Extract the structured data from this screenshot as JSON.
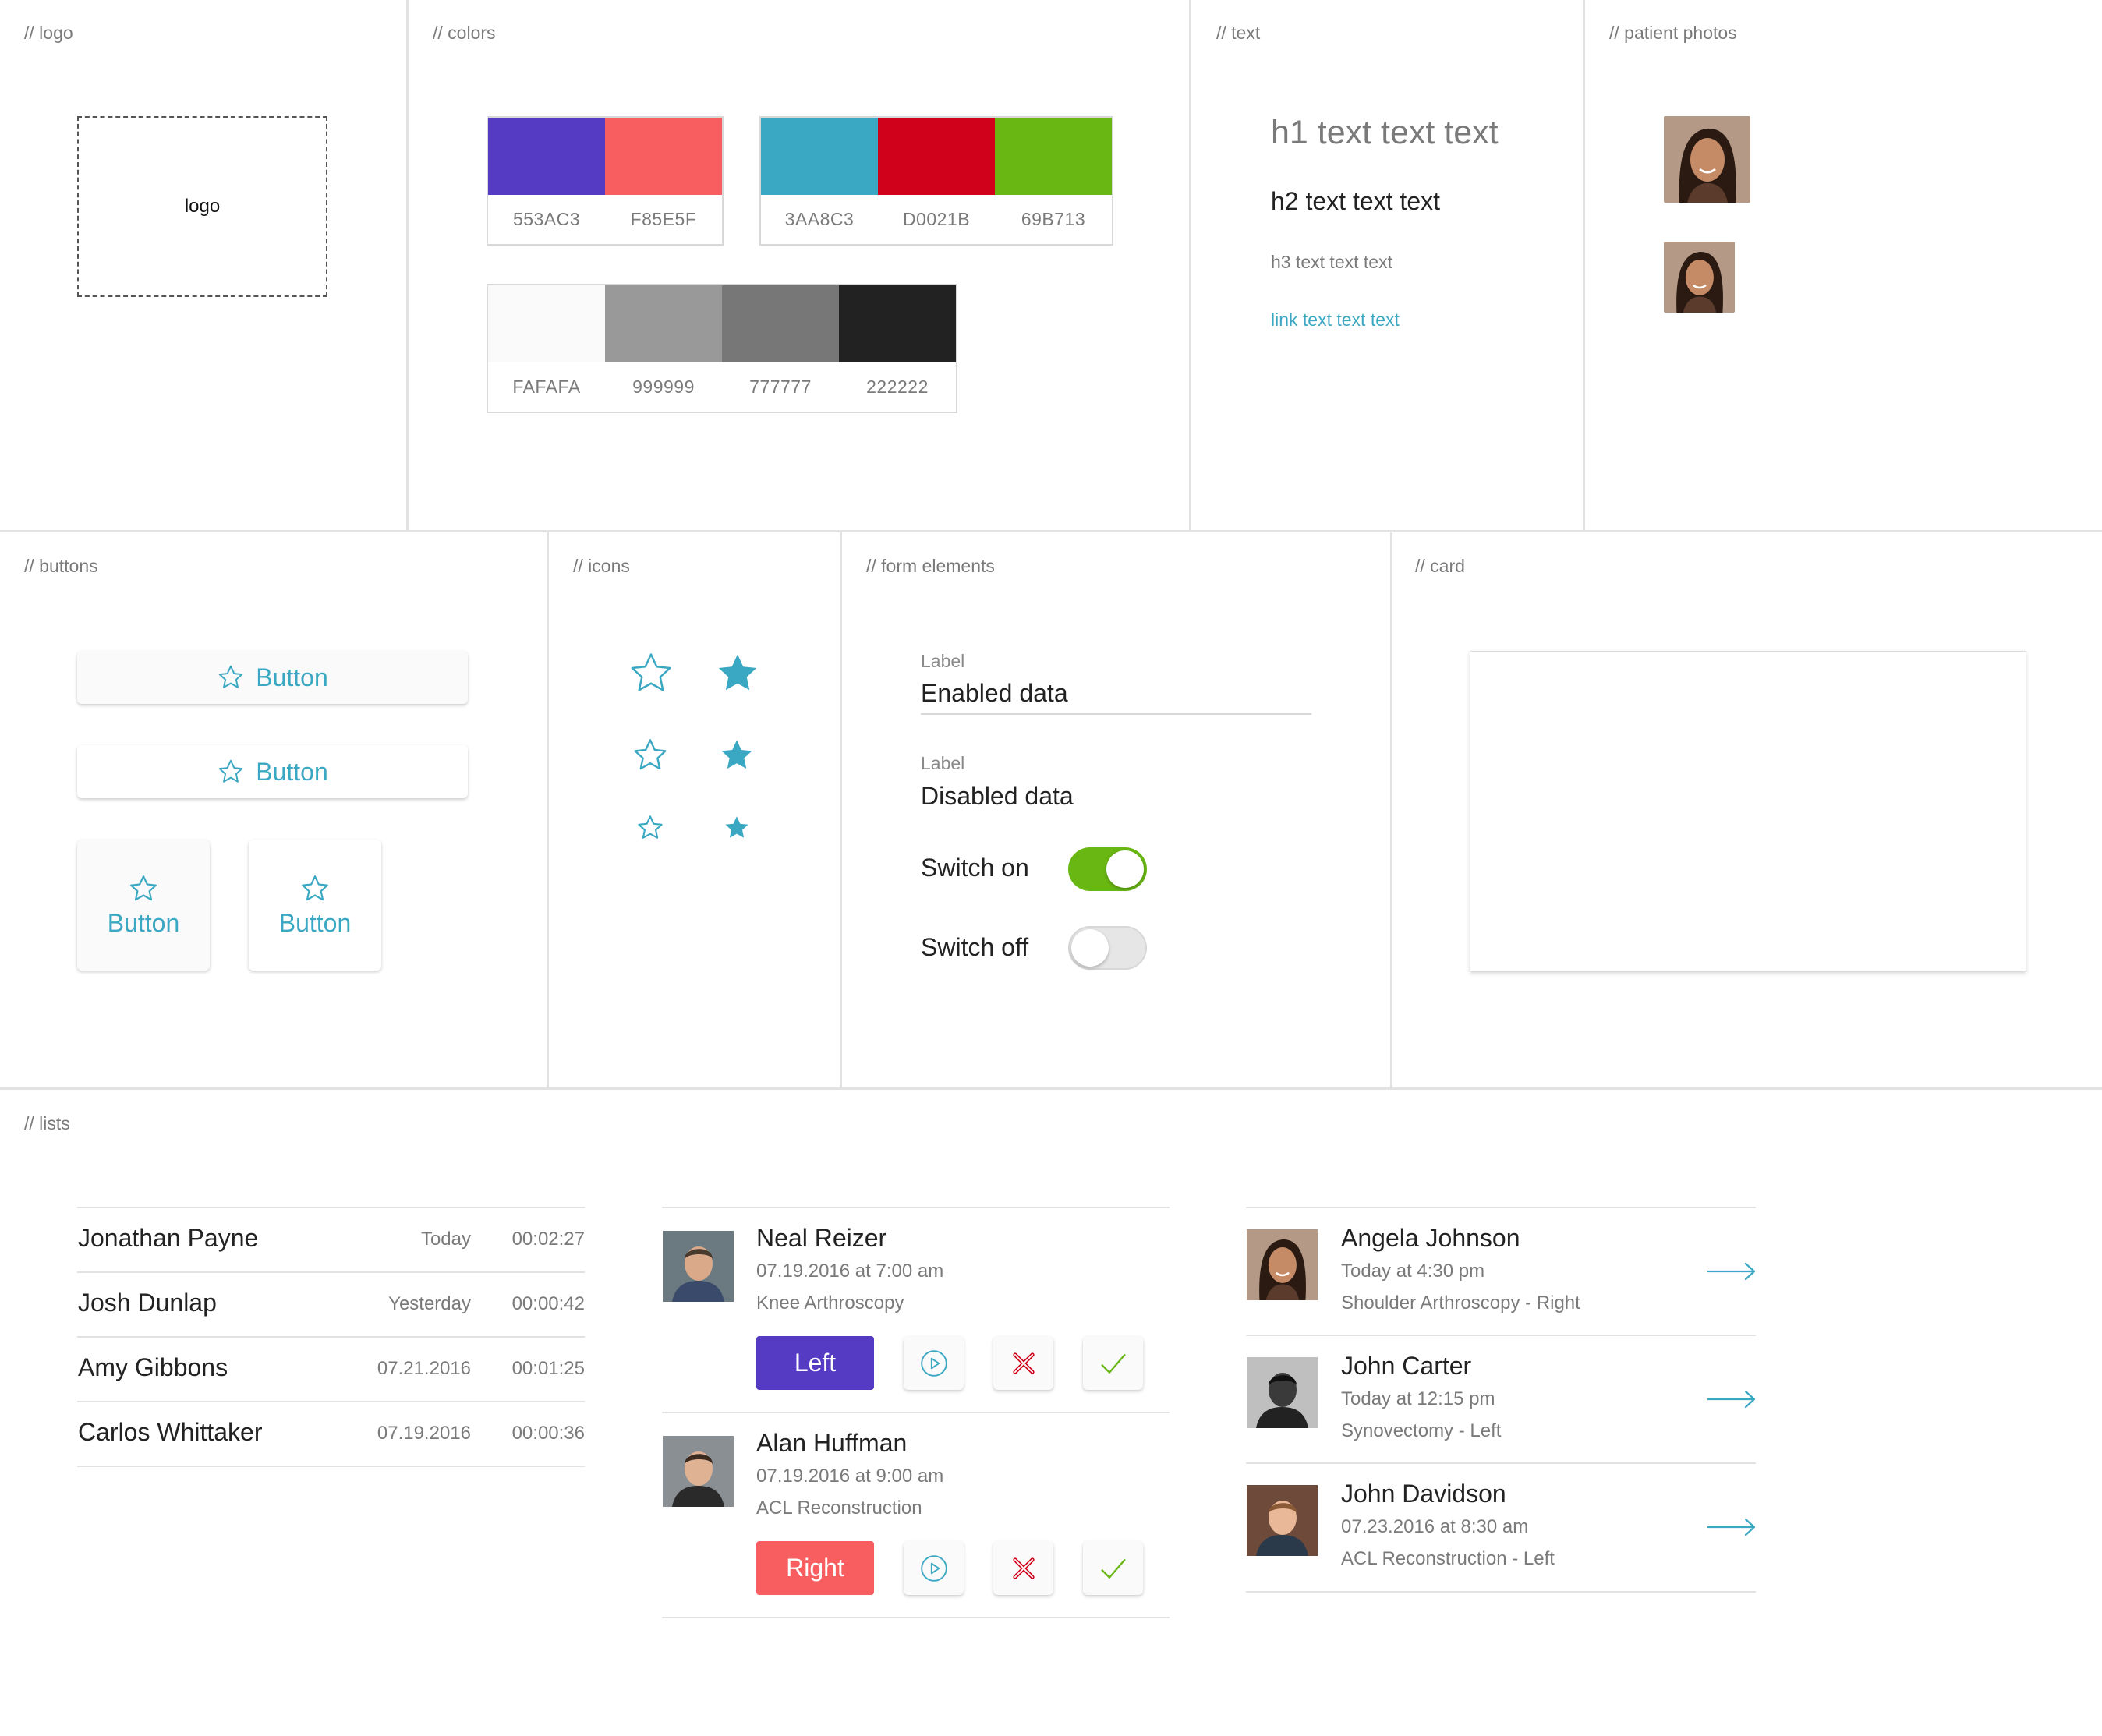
{
  "sections": {
    "logo": "// logo",
    "colors": "// colors",
    "text": "// text",
    "photos": "// patient photos",
    "buttons": "// buttons",
    "icons": "// icons",
    "form": "// form elements",
    "card": "// card",
    "lists": "// lists"
  },
  "logo_placeholder": "logo",
  "colors": {
    "brand": [
      {
        "hex": "#553AC3",
        "code": "553AC3"
      },
      {
        "hex": "#F85E5F",
        "code": "F85E5F"
      }
    ],
    "status": [
      {
        "hex": "#3AA8C3",
        "code": "3AA8C3"
      },
      {
        "hex": "#D0021B",
        "code": "D0021B"
      },
      {
        "hex": "#69B713",
        "code": "69B713"
      }
    ],
    "grays": [
      {
        "hex": "#FAFAFA",
        "code": "FAFAFA"
      },
      {
        "hex": "#999999",
        "code": "999999"
      },
      {
        "hex": "#777777",
        "code": "777777"
      },
      {
        "hex": "#222222",
        "code": "222222"
      }
    ]
  },
  "text_samples": {
    "h1": "h1 text text text",
    "h2": "h2 text text text",
    "h3": "h3 text text text",
    "link": "link text text text"
  },
  "buttons": {
    "raised_label": "Button",
    "flat_label": "Button",
    "square_raised_label": "Button",
    "square_flat_label": "Button",
    "icon": "star-outline-icon"
  },
  "icons": [
    "star-outline-icon",
    "star-filled-icon"
  ],
  "form": {
    "enabled_label": "Label",
    "enabled_value": "Enabled data",
    "disabled_label": "Label",
    "disabled_value": "Disabled data",
    "switch_on_label": "Switch on",
    "switch_off_label": "Switch off",
    "switch_on_state": true,
    "switch_off_state": false
  },
  "lists": {
    "calls": [
      {
        "name": "Jonathan Payne",
        "date": "Today",
        "duration": "00:02:27"
      },
      {
        "name": "Josh Dunlap",
        "date": "Yesterday",
        "duration": "00:00:42"
      },
      {
        "name": "Amy Gibbons",
        "date": "07.21.2016",
        "duration": "00:01:25"
      },
      {
        "name": "Carlos Whittaker",
        "date": "07.19.2016",
        "duration": "00:00:36"
      }
    ],
    "cases": [
      {
        "name": "Neal Reizer",
        "datetime": "07.19.2016 at 7:00 am",
        "procedure": "Knee Arthroscopy",
        "side": "Left",
        "side_color": "#553AC3"
      },
      {
        "name": "Alan Huffman",
        "datetime": "07.19.2016 at 9:00 am",
        "procedure": "ACL Reconstruction",
        "side": "Right",
        "side_color": "#F85E5F"
      }
    ],
    "case_actions": [
      "play-icon",
      "close-icon",
      "check-icon"
    ],
    "patients": [
      {
        "name": "Angela Johnson",
        "datetime": "Today at 4:30 pm",
        "procedure": "Shoulder Arthroscopy - Right"
      },
      {
        "name": "John Carter",
        "datetime": "Today at 12:15 pm",
        "procedure": "Synovectomy - Left"
      },
      {
        "name": "John Davidson",
        "datetime": "07.23.2016 at 8:30 am",
        "procedure": "ACL Reconstruction - Left"
      }
    ]
  }
}
